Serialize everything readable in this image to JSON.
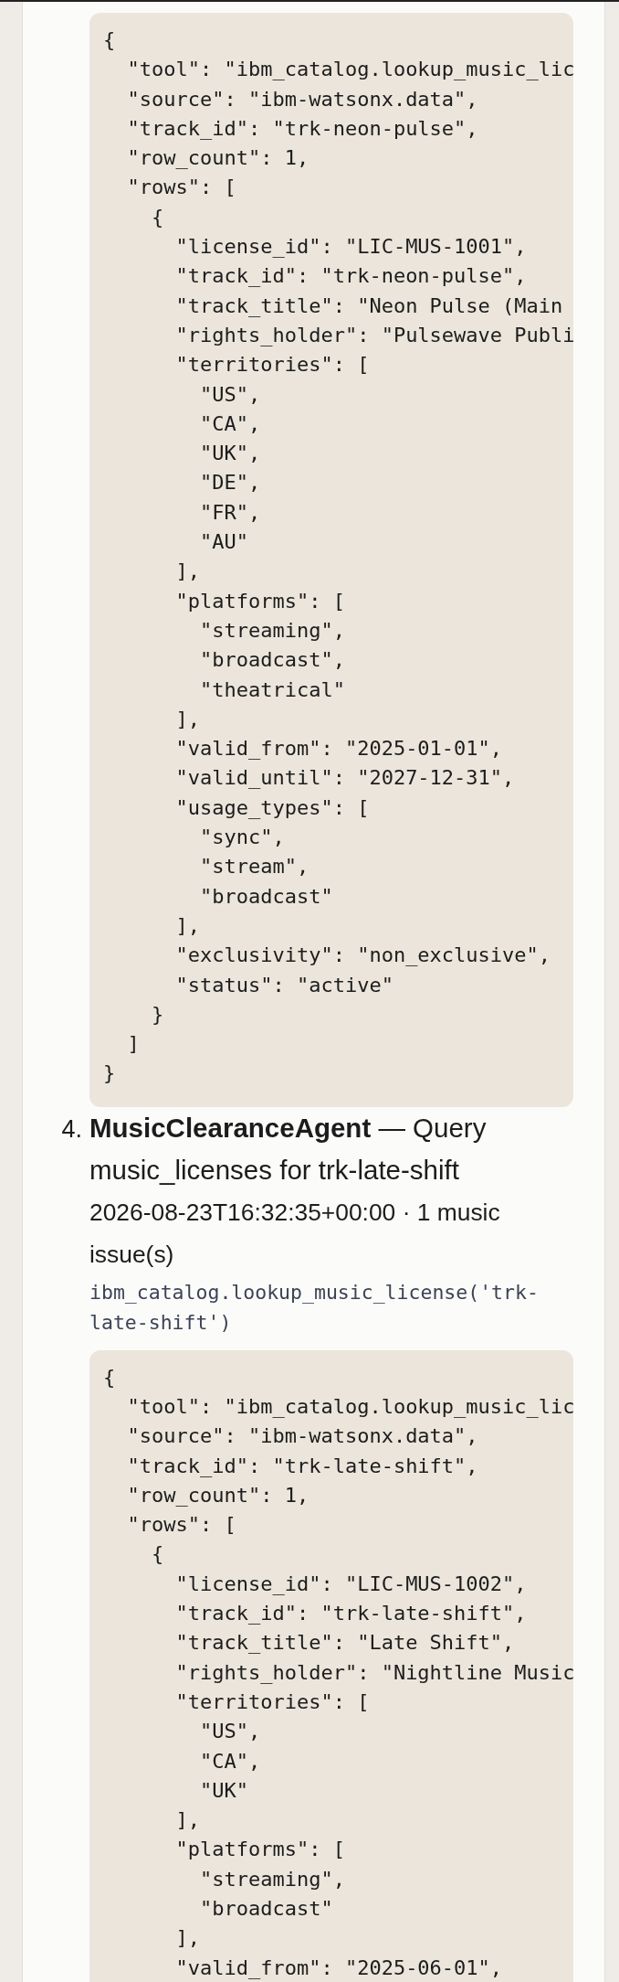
{
  "steps": [
    {
      "output_lines": [
        "{",
        "  \"tool\": \"ibm_catalog.lookup_music_lic",
        "  \"source\": \"ibm-watsonx.data\",",
        "  \"track_id\": \"trk-neon-pulse\",",
        "  \"row_count\": 1,",
        "  \"rows\": [",
        "    {",
        "      \"license_id\": \"LIC-MUS-1001\",",
        "      \"track_id\": \"trk-neon-pulse\",",
        "      \"track_title\": \"Neon Pulse (Main",
        "      \"rights_holder\": \"Pulsewave Publi",
        "      \"territories\": [",
        "        \"US\",",
        "        \"CA\",",
        "        \"UK\",",
        "        \"DE\",",
        "        \"FR\",",
        "        \"AU\"",
        "      ],",
        "      \"platforms\": [",
        "        \"streaming\",",
        "        \"broadcast\",",
        "        \"theatrical\"",
        "      ],",
        "      \"valid_from\": \"2025-01-01\",",
        "      \"valid_until\": \"2027-12-31\",",
        "      \"usage_types\": [",
        "        \"sync\",",
        "        \"stream\",",
        "        \"broadcast\"",
        "      ],",
        "      \"exclusivity\": \"non_exclusive\",",
        "      \"status\": \"active\"",
        "    }",
        "  ]",
        "}"
      ]
    },
    {
      "number": "4.",
      "heading": "**MusicClearanceAgent** — Query music_licenses for trk-late-shift",
      "meta": "2026-08-23T16:32:35+00:00 · 1 music issue(s)",
      "call": "ibm_catalog.lookup_music_license('trk-late-shift')",
      "output_lines": [
        "{",
        "  \"tool\": \"ibm_catalog.lookup_music_lic",
        "  \"source\": \"ibm-watsonx.data\",",
        "  \"track_id\": \"trk-late-shift\",",
        "  \"row_count\": 1,",
        "  \"rows\": [",
        "    {",
        "      \"license_id\": \"LIC-MUS-1002\",",
        "      \"track_id\": \"trk-late-shift\",",
        "      \"track_title\": \"Late Shift\",",
        "      \"rights_holder\": \"Nightline Music",
        "      \"territories\": [",
        "        \"US\",",
        "        \"CA\",",
        "        \"UK\"",
        "      ],",
        "      \"platforms\": [",
        "        \"streaming\",",
        "        \"broadcast\"",
        "      ],",
        "      \"valid_from\": \"2025-06-01\","
      ]
    }
  ]
}
